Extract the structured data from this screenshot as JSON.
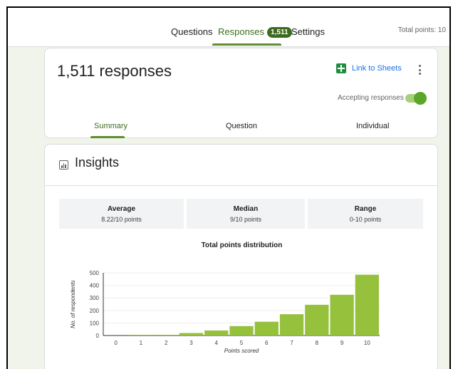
{
  "header": {
    "tabs": [
      {
        "label": "Questions"
      },
      {
        "label": "Responses",
        "badge": "1,511",
        "active": true
      },
      {
        "label": "Settings"
      }
    ],
    "total_points": "Total points: 10"
  },
  "summary_card": {
    "response_count": "1,511 responses",
    "link_sheets": "Link to Sheets",
    "accepting_label": "Accepting responses",
    "accepting_on": true,
    "tabs": [
      {
        "label": "Summary",
        "active": true
      },
      {
        "label": "Question"
      },
      {
        "label": "Individual"
      }
    ]
  },
  "insights": {
    "title": "Insights",
    "stats": [
      {
        "label": "Average",
        "value": "8.22/10 points"
      },
      {
        "label": "Median",
        "value": "9/10 points"
      },
      {
        "label": "Range",
        "value": "0-10 points"
      }
    ]
  },
  "colors": {
    "accent": "#3a6e1e",
    "bar": "#96c13d",
    "background": "#f0f4ea",
    "sheets_green": "#1e8e3e",
    "link_blue": "#1a73e8"
  },
  "chart_data": {
    "type": "bar",
    "title": "Total points distribution",
    "xlabel": "Points scored",
    "ylabel": "No. of respondents",
    "categories": [
      "0",
      "1",
      "2",
      "3",
      "4",
      "5",
      "6",
      "7",
      "8",
      "9",
      "10"
    ],
    "values": [
      0,
      1,
      3,
      20,
      40,
      75,
      110,
      170,
      245,
      325,
      485
    ],
    "ylim": [
      0,
      500
    ],
    "yticks": [
      0,
      100,
      200,
      300,
      400,
      500
    ],
    "grid": true,
    "legend": "none"
  }
}
